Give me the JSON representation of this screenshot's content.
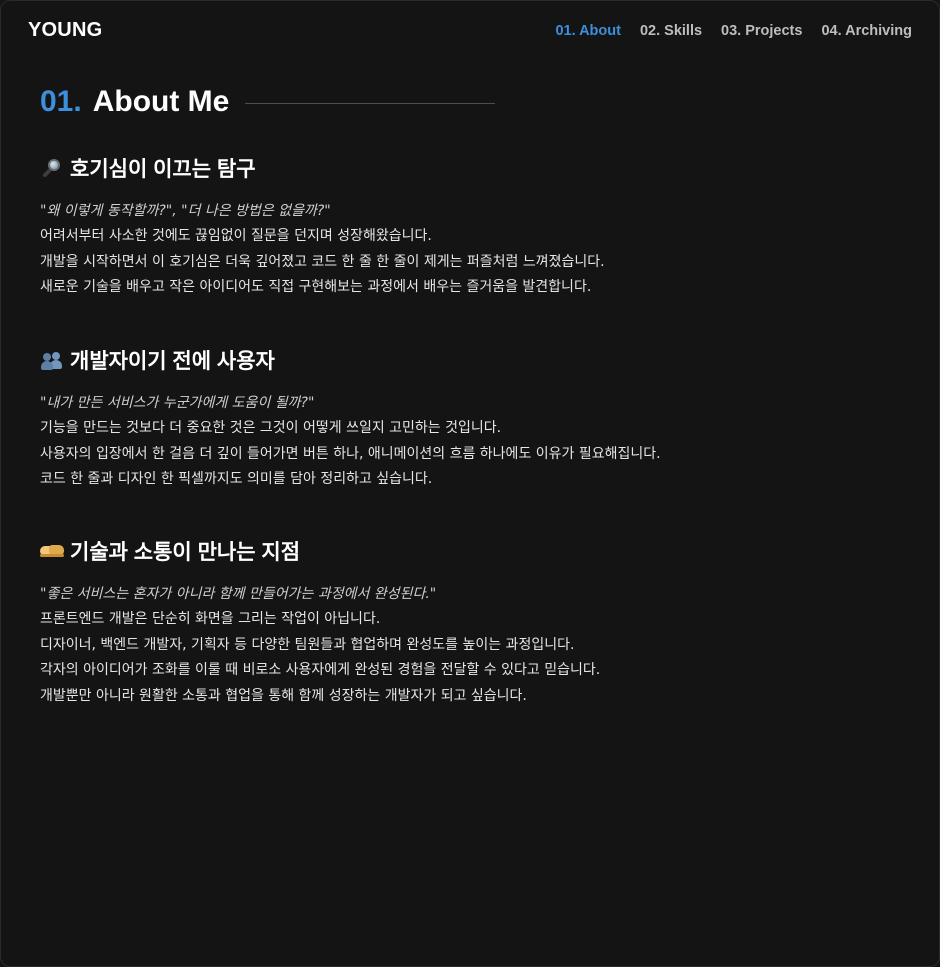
{
  "header": {
    "logo": "YOUNG",
    "nav": [
      {
        "label": "01. About",
        "active": true
      },
      {
        "label": "02. Skills",
        "active": false
      },
      {
        "label": "03. Projects",
        "active": false
      },
      {
        "label": "04. Archiving",
        "active": false
      }
    ]
  },
  "section": {
    "number": "01.",
    "title": "About Me"
  },
  "blocks": [
    {
      "icon": "magnifying-glass-icon",
      "heading": "호기심이 이끄는 탐구",
      "quote": "\"왜 이렇게 동작할까?\", \"더 나은 방법은 없을까?\"",
      "lines": [
        "어려서부터 사소한 것에도 끊임없이 질문을 던지며 성장해왔습니다.",
        "개발을 시작하면서 이 호기심은 더욱 깊어졌고 코드 한 줄 한 줄이 제게는 퍼즐처럼 느껴졌습니다.",
        "새로운 기술을 배우고 작은 아이디어도 직접 구현해보는 과정에서 배우는 즐거움을 발견합니다."
      ]
    },
    {
      "icon": "people-icon",
      "heading": "개발자이기 전에 사용자",
      "quote": "\"내가 만든 서비스가 누군가에게 도움이 될까?\"",
      "lines": [
        "기능을 만드는 것보다 더 중요한 것은 그것이 어떻게 쓰일지 고민하는 것입니다.",
        "사용자의 입장에서 한 걸음 더 깊이 들어가면 버튼 하나, 애니메이션의 흐름 하나에도 이유가 필요해집니다.",
        "코드 한 줄과 디자인 한 픽셀까지도 의미를 담아 정리하고 싶습니다."
      ]
    },
    {
      "icon": "handshake-icon",
      "heading": "기술과 소통이 만나는 지점",
      "quote": "\"좋은 서비스는 혼자가 아니라 함께 만들어가는 과정에서 완성된다.\"",
      "lines": [
        "프론트엔드 개발은 단순히 화면을 그리는 작업이 아닙니다.",
        "디자이너, 백엔드 개발자, 기획자 등 다양한 팀원들과 협업하며 완성도를 높이는 과정입니다.",
        "각자의 아이디어가 조화를 이룰 때 비로소 사용자에게 완성된 경험을 전달할 수 있다고 믿습니다.",
        "개발뿐만 아니라 원활한 소통과 협업을 통해 함께 성장하는 개발자가 되고 싶습니다."
      ]
    }
  ],
  "colors": {
    "background": "#141414",
    "accent": "#3b8fdb",
    "text": "#ececec",
    "nav_inactive": "#bdbdbd"
  }
}
